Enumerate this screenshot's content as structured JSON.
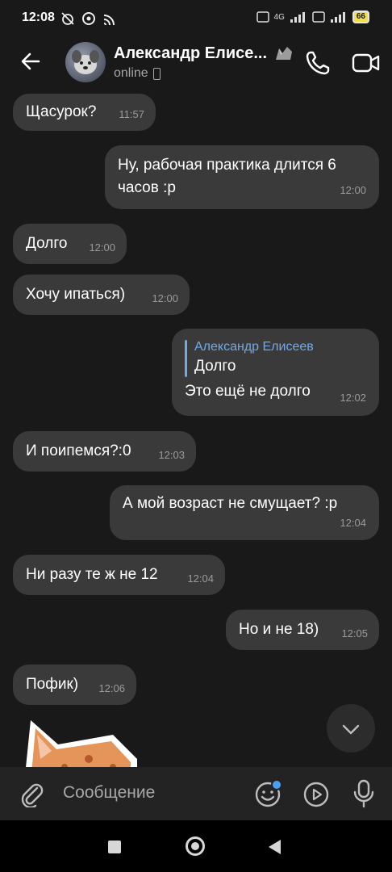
{
  "statusbar": {
    "time": "12:08",
    "network_label": "4G",
    "battery": "66"
  },
  "header": {
    "name": "Александр Елисе...",
    "status": "online"
  },
  "messages": [
    {
      "direction": "in",
      "text": "Щасурок?",
      "time": "11:57"
    },
    {
      "direction": "out",
      "text": "Ну, рабочая практика длится 6 часов :р",
      "time": "12:00"
    },
    {
      "direction": "in",
      "text": "Долго",
      "time": "12:00"
    },
    {
      "direction": "in",
      "text": "Хочу ипаться)",
      "time": "12:00"
    },
    {
      "direction": "out",
      "reply": {
        "author": "Александр Елисеев",
        "text": "Долго"
      },
      "text": "Это ещё не долго",
      "time": "12:02"
    },
    {
      "direction": "in",
      "text": "И поипемся?:0",
      "time": "12:03"
    },
    {
      "direction": "out",
      "text": "А мой возраст не смущает? :р",
      "time": "12:04"
    },
    {
      "direction": "in",
      "text": "Ни разу те ж не 12",
      "time": "12:04"
    },
    {
      "direction": "out",
      "text": "Но и не 18)",
      "time": "12:05"
    },
    {
      "direction": "in",
      "text": "Пофик)",
      "time": "12:06"
    }
  ],
  "composer": {
    "placeholder": "Сообщение"
  },
  "colors": {
    "background": "#191919",
    "bubble": "#3a3a3a",
    "accent": "#71aaeb"
  }
}
